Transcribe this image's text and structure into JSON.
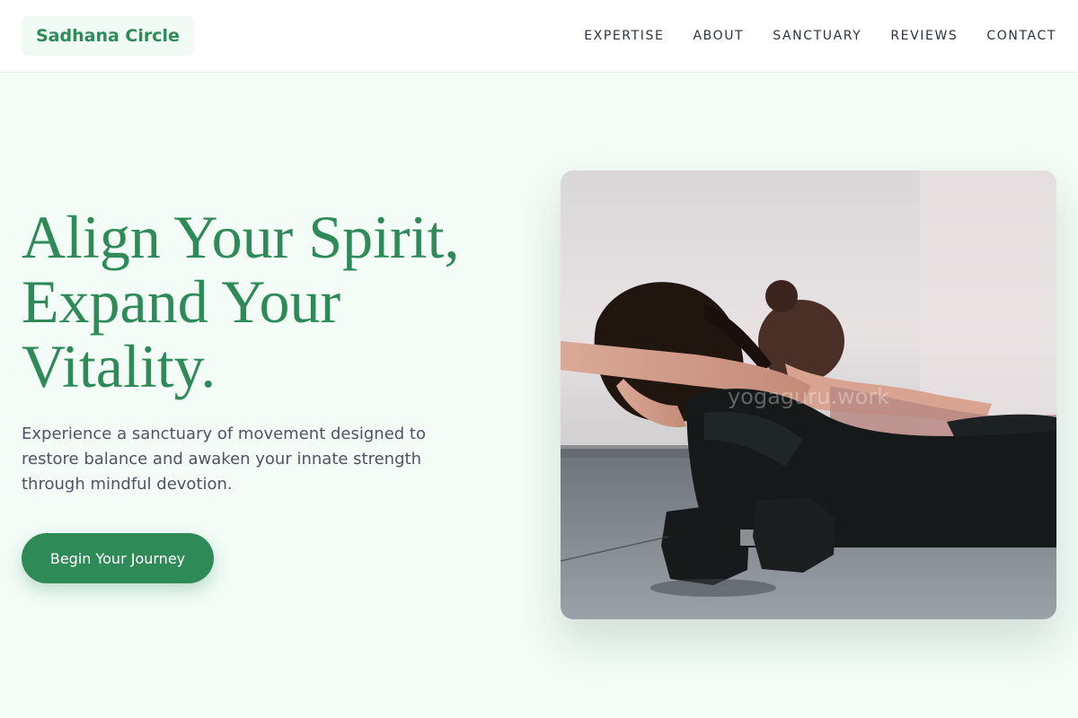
{
  "brand": {
    "name": "Sadhana Circle"
  },
  "nav": {
    "items": [
      "EXPERTISE",
      "ABOUT",
      "SANCTUARY",
      "REVIEWS",
      "CONTACT"
    ]
  },
  "hero": {
    "title_lines": [
      "Align Your Spirit,",
      "Expand Your",
      "Vitality."
    ],
    "description": "Experience a sanctuary of movement designed to restore balance and awaken your innate strength through mindful devotion.",
    "cta_label": "Begin Your Journey",
    "image_watermark": "yogaguru.work"
  },
  "colors": {
    "brand": "#2e8b57",
    "background": "#f3fcf7",
    "text_muted": "#4b5563"
  }
}
